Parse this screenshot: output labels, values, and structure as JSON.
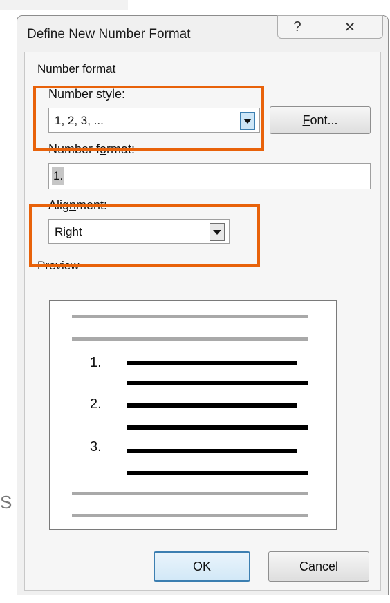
{
  "background": {
    "partial_text": "S"
  },
  "dialog": {
    "title": "Define New Number Format",
    "help_icon": "?",
    "close_icon": "✕"
  },
  "number_format_group": {
    "label": "Number format",
    "number_style": {
      "label_pre": "",
      "label_u": "N",
      "label_post": "umber style:",
      "value": "1, 2, 3, ..."
    },
    "font_button": {
      "label_u": "F",
      "label_post": "ont..."
    },
    "number_format": {
      "label_pre": "Number f",
      "label_u": "o",
      "label_post": "rmat:",
      "value": "1."
    },
    "alignment": {
      "label_pre": "Alig",
      "label_u": "n",
      "label_post": "ment:",
      "value": "Right"
    }
  },
  "preview_group": {
    "label": "Preview",
    "numbers": [
      "1.",
      "2.",
      "3."
    ]
  },
  "buttons": {
    "ok": "OK",
    "cancel": "Cancel"
  },
  "colors": {
    "highlight": "#e8620a",
    "accent": "#3c7fb1"
  }
}
